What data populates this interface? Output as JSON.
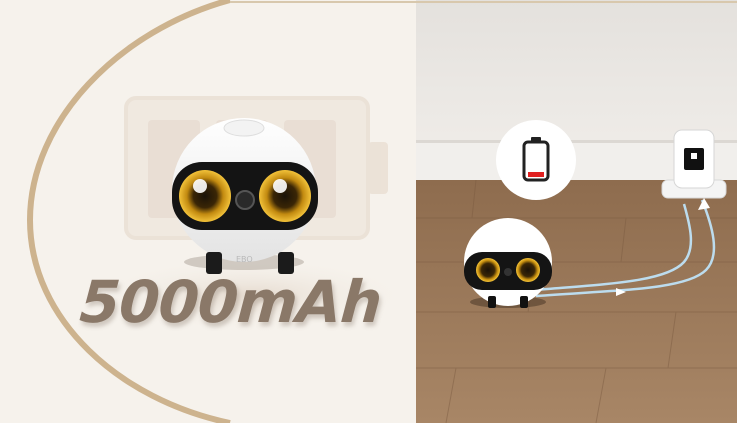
{
  "battery_capacity": "5000mAh",
  "robot_brand_mark": "EBO",
  "colors": {
    "background": "#f6f2ec",
    "arc_gold": "#c9b28c",
    "battery_ghost": "#e8ddd2",
    "capacity_text": "#8a7868",
    "low_battery_red": "#e02020",
    "wood_floor": "#9a7858",
    "wall": "#eae6e1",
    "path_blue": "#b8d8ea"
  },
  "icons": [
    "battery-outline-icon",
    "low-battery-icon",
    "charging-dock-icon",
    "robot-camera-icon"
  ]
}
